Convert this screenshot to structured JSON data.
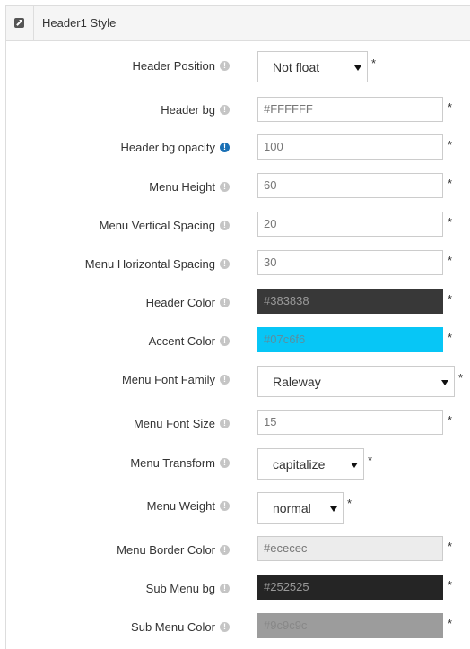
{
  "panel": {
    "title": "Header1 Style",
    "icon": "external-link-icon"
  },
  "fields": [
    {
      "label": "Header Position",
      "type": "select",
      "value": "Not float",
      "required": "*"
    },
    {
      "label": "Header bg",
      "type": "text",
      "value": "#FFFFFF",
      "required": "*"
    },
    {
      "label": "Header bg opacity",
      "type": "text",
      "value": "100",
      "required": "*",
      "info_color": "#1a70b5"
    },
    {
      "label": "Menu Height",
      "type": "text",
      "value": "60",
      "required": "*"
    },
    {
      "label": "Menu Vertical Spacing",
      "type": "text",
      "value": "20",
      "required": "*"
    },
    {
      "label": "Menu Horizontal Spacing",
      "type": "text",
      "value": "30",
      "required": "*"
    },
    {
      "label": "Header Color",
      "type": "color",
      "value": "#383838",
      "required": "*",
      "bg": "#383838"
    },
    {
      "label": "Accent Color",
      "type": "color",
      "value": "#07c6f6",
      "required": "*",
      "bg": "#07c6f6"
    },
    {
      "label": "Menu Font Family",
      "type": "select",
      "value": "Raleway",
      "required": "*"
    },
    {
      "label": "Menu Font Size",
      "type": "text",
      "value": "15",
      "required": "*"
    },
    {
      "label": "Menu Transform",
      "type": "select",
      "value": "capitalize",
      "required": "*"
    },
    {
      "label": "Menu Weight",
      "type": "select",
      "value": "normal",
      "required": "*"
    },
    {
      "label": "Menu Border Color",
      "type": "color",
      "value": "#ececec",
      "required": "*",
      "bg": "#ececec"
    },
    {
      "label": "Sub Menu bg",
      "type": "color",
      "value": "#252525",
      "required": "*",
      "bg": "#252525"
    },
    {
      "label": "Sub Menu Color",
      "type": "color",
      "value": "#9c9c9c",
      "required": "*",
      "bg": "#9c9c9c"
    }
  ],
  "info_icon": "info-icon",
  "info_glyph": "!"
}
